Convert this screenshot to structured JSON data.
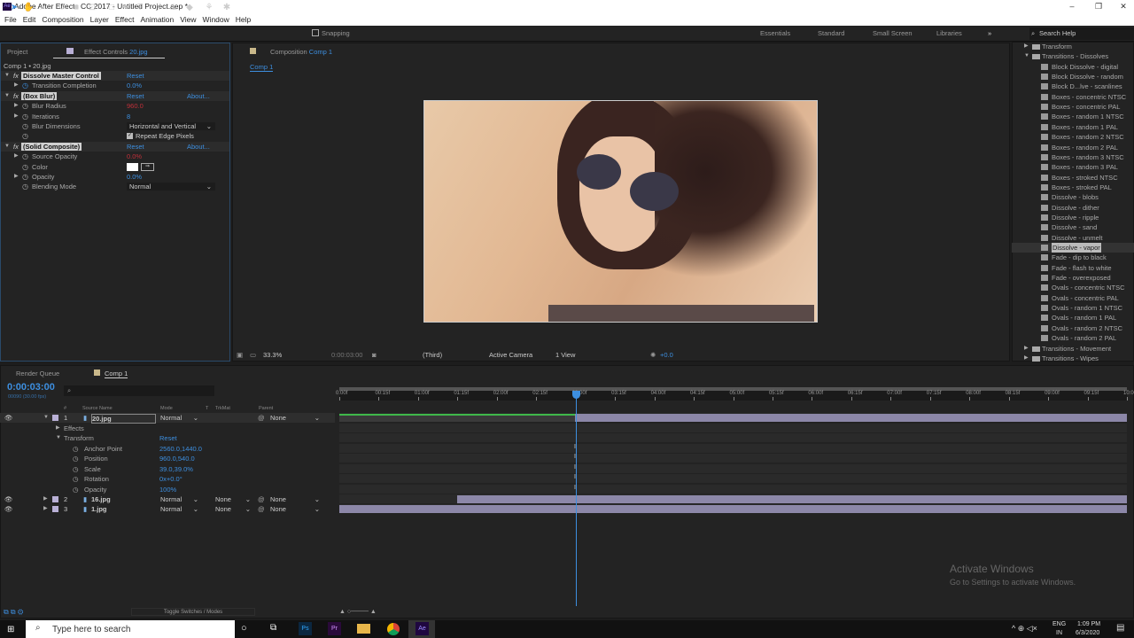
{
  "window": {
    "title": "Adobe After Effects CC 2017 - Untitled Project.aep *",
    "app_icon": "Ae",
    "controls": [
      "–",
      "❐",
      "✕"
    ]
  },
  "menu": [
    "File",
    "Edit",
    "Composition",
    "Layer",
    "Effect",
    "Animation",
    "View",
    "Window",
    "Help"
  ],
  "toolbar": {
    "snapping": "Snapping",
    "workspaces": [
      "Essentials",
      "Standard",
      "Small Screen",
      "Libraries"
    ],
    "more": "»",
    "search_placeholder": "Search Help"
  },
  "left_panel": {
    "tab_project": "Project",
    "tab_effect_controls": "Effect Controls",
    "tab_layer": "20.jpg",
    "breadcrumb": "Comp 1 • 20.jpg",
    "effects": [
      {
        "name": "Dissolve Master Control",
        "reset": "Reset",
        "props": [
          {
            "label": "Transition Completion",
            "value": "0.0%",
            "color": "blue",
            "twirl": true
          }
        ]
      },
      {
        "name": "(Box Blur)",
        "reset": "Reset",
        "about": "About...",
        "props": [
          {
            "label": "Blur Radius",
            "value": "960.0",
            "color": "red",
            "twirl": true
          },
          {
            "label": "Iterations",
            "value": "8",
            "color": "blue",
            "twirl": true
          },
          {
            "label": "Blur Dimensions",
            "dropdown": "Horizontal and Vertical"
          },
          {
            "label": "",
            "checkbox": "Repeat Edge Pixels",
            "checked": true
          }
        ]
      },
      {
        "name": "(Solid Composite)",
        "reset": "Reset",
        "about": "About...",
        "props": [
          {
            "label": "Source Opacity",
            "value": "0.0%",
            "color": "red",
            "twirl": true
          },
          {
            "label": "Color",
            "swatch": "#ffffff"
          },
          {
            "label": "Opacity",
            "value": "0.0%",
            "color": "blue",
            "twirl": true
          },
          {
            "label": "Blending Mode",
            "dropdown": "Normal"
          }
        ]
      }
    ]
  },
  "viewer": {
    "tab_label": "Composition",
    "tab_comp": "Comp 1",
    "subtab": "Comp 1",
    "zoom": "33.3%",
    "time": "0:00:03:00",
    "resolution": "(Third)",
    "camera": "Active Camera",
    "views": "1 View",
    "exposure": "+0.0"
  },
  "effects_presets": {
    "items": [
      {
        "label": "Transform",
        "type": "folder",
        "open": false
      },
      {
        "label": "Transitions - Dissolves",
        "type": "folder",
        "open": true
      },
      {
        "label": "Block Dissolve - digital",
        "type": "preset"
      },
      {
        "label": "Block Dissolve - random",
        "type": "preset"
      },
      {
        "label": "Block D...lve - scanlines",
        "type": "preset"
      },
      {
        "label": "Boxes - concentric NTSC",
        "type": "preset"
      },
      {
        "label": "Boxes - concentric PAL",
        "type": "preset"
      },
      {
        "label": "Boxes - random 1 NTSC",
        "type": "preset"
      },
      {
        "label": "Boxes - random 1 PAL",
        "type": "preset"
      },
      {
        "label": "Boxes - random 2 NTSC",
        "type": "preset"
      },
      {
        "label": "Boxes - random 2 PAL",
        "type": "preset"
      },
      {
        "label": "Boxes - random 3 NTSC",
        "type": "preset"
      },
      {
        "label": "Boxes - random 3 PAL",
        "type": "preset"
      },
      {
        "label": "Boxes - stroked NTSC",
        "type": "preset"
      },
      {
        "label": "Boxes - stroked PAL",
        "type": "preset"
      },
      {
        "label": "Dissolve - blobs",
        "type": "preset"
      },
      {
        "label": "Dissolve - dither",
        "type": "preset"
      },
      {
        "label": "Dissolve - ripple",
        "type": "preset"
      },
      {
        "label": "Dissolve - sand",
        "type": "preset"
      },
      {
        "label": "Dissolve - unmelt",
        "type": "preset"
      },
      {
        "label": "Dissolve - vapor",
        "type": "preset",
        "selected": true
      },
      {
        "label": "Fade - dip to black",
        "type": "preset"
      },
      {
        "label": "Fade - flash to white",
        "type": "preset"
      },
      {
        "label": "Fade - overexposed",
        "type": "preset"
      },
      {
        "label": "Ovals - concentric NTSC",
        "type": "preset"
      },
      {
        "label": "Ovals - concentric PAL",
        "type": "preset"
      },
      {
        "label": "Ovals - random 1 NTSC",
        "type": "preset"
      },
      {
        "label": "Ovals - random 1 PAL",
        "type": "preset"
      },
      {
        "label": "Ovals - random 2 NTSC",
        "type": "preset"
      },
      {
        "label": "Ovals - random 2 PAL",
        "type": "preset"
      },
      {
        "label": "Transitions - Movement",
        "type": "folder",
        "open": false
      },
      {
        "label": "Transitions - Wipes",
        "type": "folder",
        "open": false
      }
    ]
  },
  "timeline": {
    "tab_render": "Render Queue",
    "tab_comp": "Comp 1",
    "timecode": "0:00:03:00",
    "frames": "00090 (30.00 fps)",
    "col_num": "#",
    "col_source": "Source Name",
    "col_mode": "Mode",
    "col_t": "T",
    "col_trkmat": "TrkMat",
    "col_parent": "Parent",
    "layers": [
      {
        "num": "1",
        "name": "20.jpg",
        "mode": "Normal",
        "trkmat": "",
        "parent": "None",
        "start": 0
      },
      {
        "num": "2",
        "name": "16.jpg",
        "mode": "Normal",
        "trkmat": "None",
        "parent": "None",
        "start": 1.5
      },
      {
        "num": "3",
        "name": "1.jpg",
        "mode": "Normal",
        "trkmat": "None",
        "parent": "None",
        "start": 0
      }
    ],
    "effects_label": "Effects",
    "transform_label": "Transform",
    "transform_reset": "Reset",
    "transform": [
      {
        "label": "Anchor Point",
        "value": "2560.0,1440.0"
      },
      {
        "label": "Position",
        "value": "960.0,540.0"
      },
      {
        "label": "Scale",
        "value": "39.0,39.0%"
      },
      {
        "label": "Rotation",
        "value": "0x+0.0°"
      },
      {
        "label": "Opacity",
        "value": "100%"
      }
    ],
    "ruler": [
      "0:00f",
      "00:15f",
      "01:00f",
      "01:15f",
      "02:00f",
      "02:15f",
      "03:00f",
      "03:15f",
      "04:00f",
      "04:15f",
      "05:00f",
      "05:15f",
      "06:00f",
      "06:15f",
      "07:00f",
      "07:15f",
      "08:00f",
      "08:15f",
      "09:00f",
      "09:15f",
      "10:00f"
    ],
    "playhead_seconds": 3,
    "duration_seconds": 10,
    "toggle": "Toggle Switches / Modes"
  },
  "watermark": {
    "title": "Activate Windows",
    "subtitle": "Go to Settings to activate Windows."
  },
  "taskbar": {
    "search": "Type here to search",
    "apps": [
      "Ps",
      "Pr",
      "Files",
      "Chrome",
      "Ae"
    ],
    "lang": "ENG",
    "region": "IN",
    "time": "1:09 PM",
    "date": "6/3/2020"
  }
}
